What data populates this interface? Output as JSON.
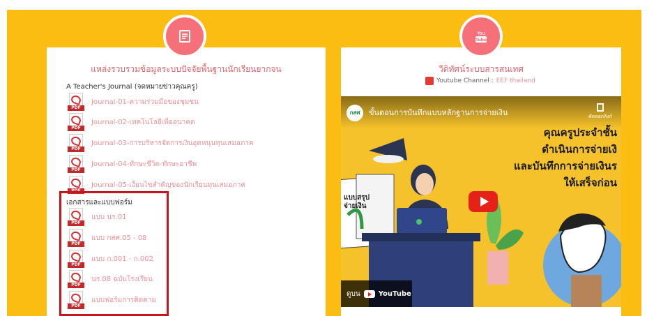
{
  "left_card": {
    "title": "แหล่งรวบรวมข้อมูลระบบปัจจัยพื้นฐานนักเรียนยากจน",
    "journal_heading": "A Teacher's Journal (จดหมายข่าวคุณครู)",
    "journals": [
      "Journal-01-ความร่วมมือของชุมชน",
      "Journal-02-เทคโนโลยีเพื่ออนาคต",
      "Journal-03-การบริหารจัดการเงินอุดหนุนทุนเสมอภาค",
      "Journal-04-ทักษะชีวิต-ทักษะอาชีพ",
      "Journal-05-เงื่อนไขสำคัญของนักเรียนทุนเสมอภาค"
    ],
    "forms_heading": "เอกสารและแบบฟอร์ม",
    "forms": [
      "แบบ นร.01",
      "แบบ กสศ.05 - 08",
      "แบบ ก.001 - ก.002",
      "นร.08 ฉบับโรงเรียน",
      "แบบฟอร์มการติดตาม"
    ],
    "pdf_tag": "PDF",
    "icon": "document-icon"
  },
  "right_card": {
    "title": "วีดิทัศน์ระบบสารสนเทศ",
    "channel_label": "Youtube Channel : ",
    "channel_link": "EEF thailand",
    "icon": "youtube-icon",
    "video": {
      "logo_text": "กสศ",
      "title": "ขั้นตอนการบันทึกแบบหลักฐานการจ่ายเงิน",
      "share_label": "คัดลอกลิงก์",
      "lines": [
        "คุณครูประจำชั้น",
        "ดำเนินการจ่ายเงิ",
        "และบันทึกการจ่ายเงินร",
        "ให้เสร็จก่อน"
      ],
      "paper_text": "แบบสรุป\nจ่ายเงิน",
      "watch_on": "ดูบน",
      "youtube_brand": "YouTube"
    }
  },
  "colors": {
    "background": "#fbbd11",
    "accent": "#f6707a",
    "link": "#f28f98",
    "highlight_box": "#c8151d"
  }
}
